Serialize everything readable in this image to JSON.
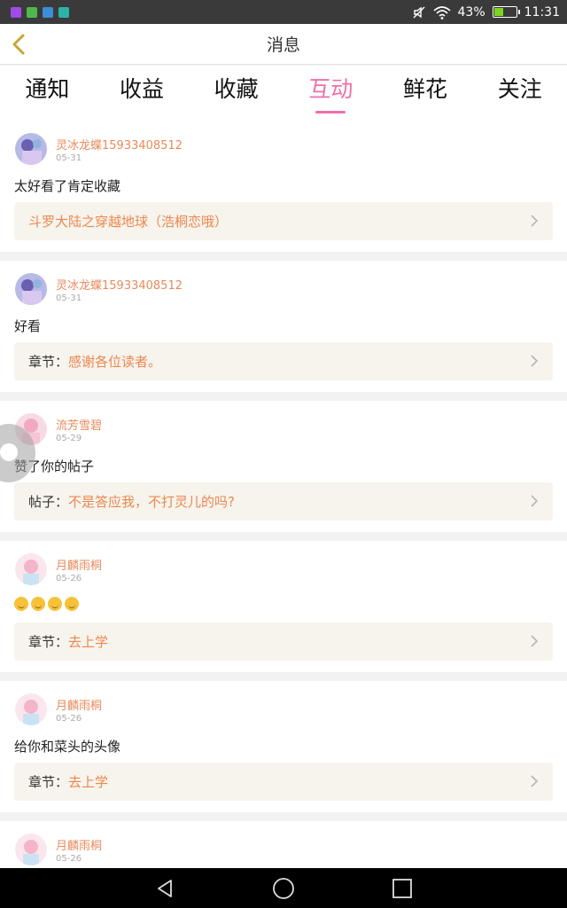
{
  "status_bar": {
    "app_icons": [
      {
        "name": "app-icon-purple",
        "color": "#a04be8"
      },
      {
        "name": "app-icon-green",
        "color": "#4fb84a"
      },
      {
        "name": "app-icon-blue",
        "color": "#3a8fd8"
      },
      {
        "name": "app-icon-teal",
        "color": "#2bb3a7"
      }
    ],
    "battery": "43%",
    "battery_level": 0.43,
    "time": "11:31"
  },
  "header": {
    "title": "消息",
    "back_icon": "chevron-left-icon",
    "accent_color": "#c8a633"
  },
  "tabs": [
    {
      "label": "通知",
      "active": false
    },
    {
      "label": "收益",
      "active": false
    },
    {
      "label": "收藏",
      "active": false
    },
    {
      "label": "互动",
      "active": true
    },
    {
      "label": "鲜花",
      "active": false
    },
    {
      "label": "关注",
      "active": false
    }
  ],
  "items": [
    {
      "user": "灵冰龙蝶15933408512",
      "date": "05-31",
      "text": "太好看了肯定收藏",
      "ref_label": "",
      "ref_title": "斗罗大陆之穿越地球（浩桐恋哦）"
    },
    {
      "user": "灵冰龙蝶15933408512",
      "date": "05-31",
      "text": "好看",
      "ref_label": "章节：",
      "ref_title": "感谢各位读者。"
    },
    {
      "user": "流芳雪碧",
      "date": "05-29",
      "text": "赞了你的帖子",
      "ref_label": "帖子：",
      "ref_title": "不是答应我，不打灵儿的吗?"
    },
    {
      "user": "月麟雨桐",
      "date": "05-26",
      "text": "",
      "emoji_count": 4,
      "ref_label": "章节：",
      "ref_title": "去上学"
    },
    {
      "user": "月麟雨桐",
      "date": "05-26",
      "text": "给你和菜头的头像",
      "ref_label": "章节：",
      "ref_title": "去上学"
    },
    {
      "user": "月麟雨桐",
      "date": "05-26",
      "text": "",
      "ref_label": "",
      "ref_title": ""
    }
  ],
  "nav": {
    "back": "back-triangle-icon",
    "home": "home-circle-icon",
    "recent": "recent-square-icon"
  }
}
